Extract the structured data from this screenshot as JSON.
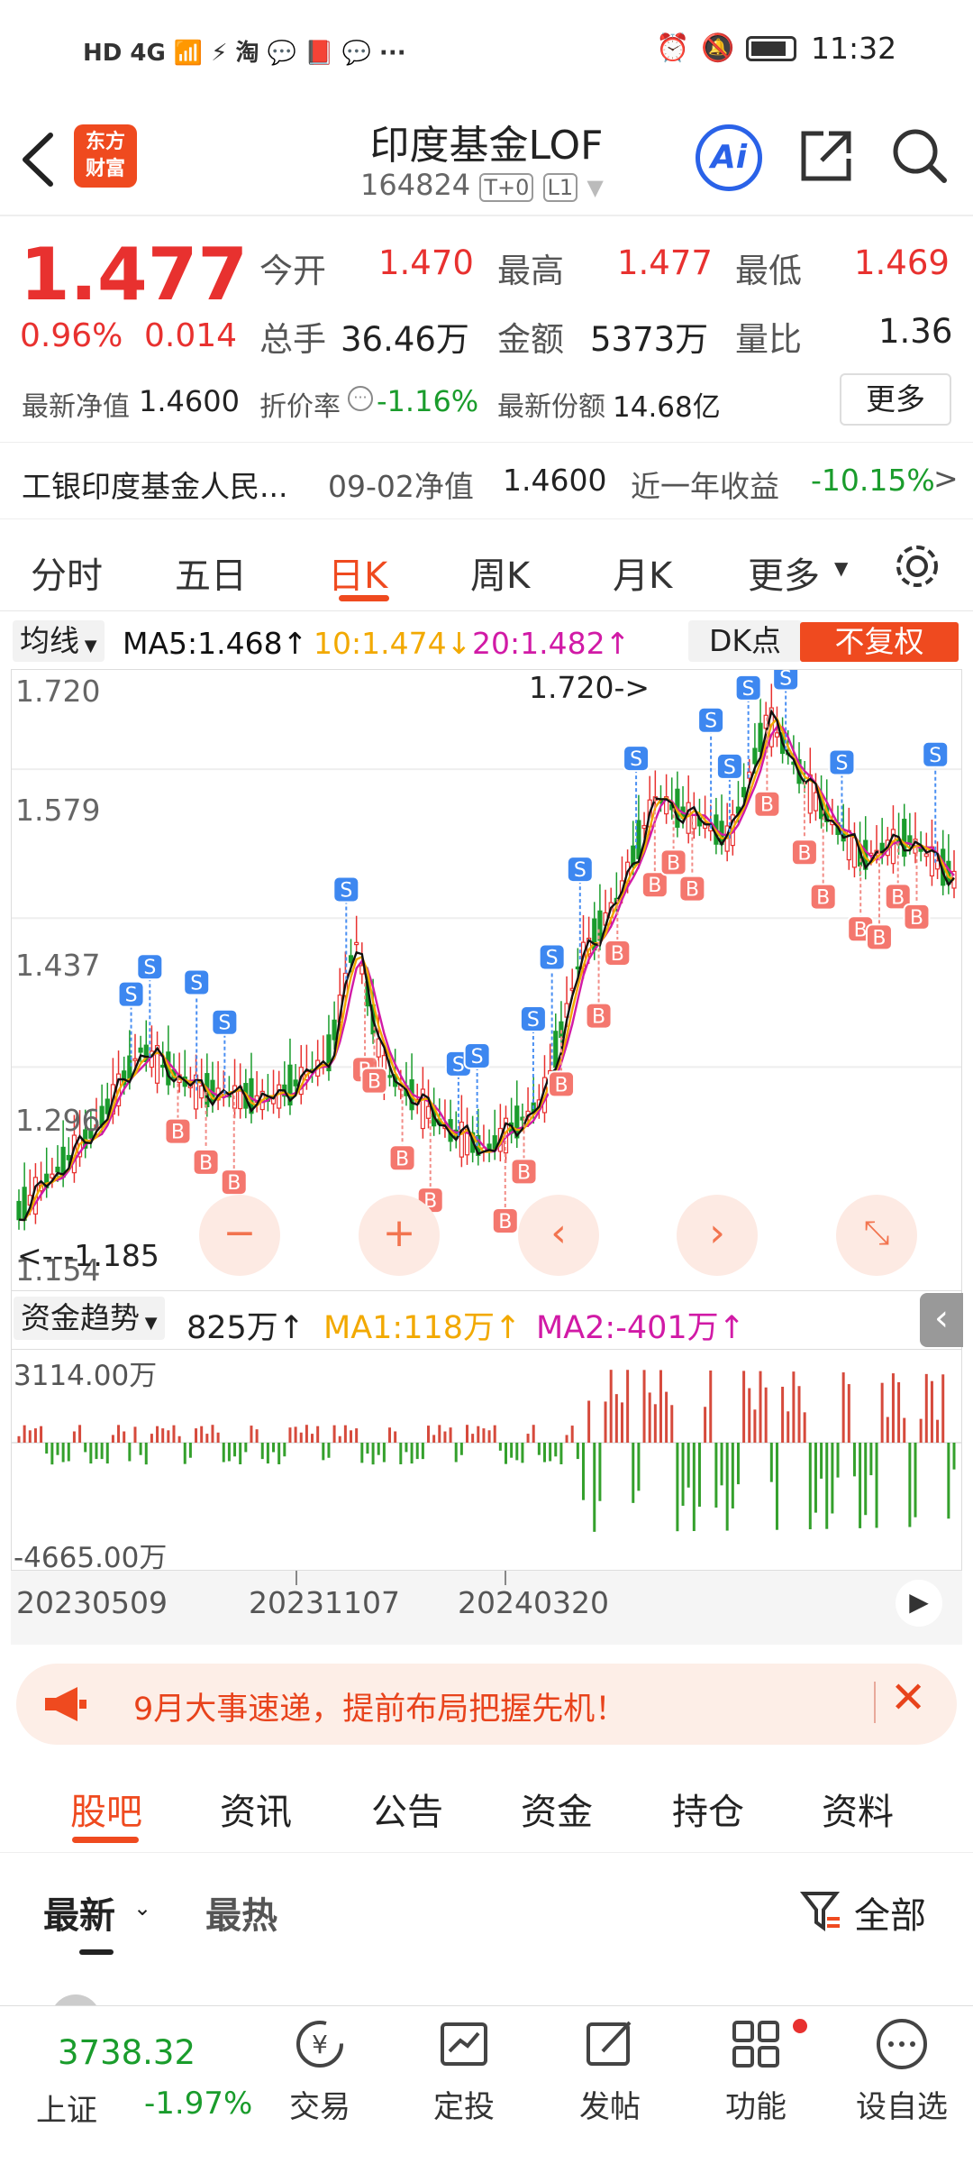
{
  "statusbar": {
    "left_icons": "HD 4G 📶 ⚡ 淘 💬 📕 💬 ···",
    "time": "11:32"
  },
  "header": {
    "logo_line1": "东方",
    "logo_line2": "财富",
    "title": "印度基金LOF",
    "code": "164824",
    "badge1": "T+0",
    "badge2": "L1",
    "ai_label": "Ai"
  },
  "quote": {
    "price": "1.477",
    "pct": "0.96%",
    "change": "0.014",
    "open_label": "今开",
    "open": "1.470",
    "high_label": "最高",
    "high": "1.477",
    "low_label": "最低",
    "low": "1.469",
    "vol_label": "总手",
    "vol": "36.46万",
    "amount_label": "金额",
    "amount": "5373万",
    "ratio_label": "量比",
    "ratio": "1.36",
    "nav_label": "最新净值",
    "nav": "1.4600",
    "discount_label": "折价率",
    "discount": "-1.16%",
    "shares_label": "最新份额",
    "shares": "14.68亿",
    "more_btn": "更多"
  },
  "fund": {
    "name": "工银印度基金人民...",
    "nav_date": "09-02净值",
    "nav_value": "1.4600",
    "year_label": "近一年收益",
    "year_value": "-10.15%",
    "arrow": ">"
  },
  "tabs": [
    "分时",
    "五日",
    "日K",
    "周K",
    "月K",
    "更多"
  ],
  "active_tab": "日K",
  "ma": {
    "selector": "均线",
    "ma5": "MA5:1.468↑",
    "ma10": "10:1.474↓",
    "ma20": "20:1.482↑",
    "dk": "DK点",
    "adjust": "不复权"
  },
  "chart_data": {
    "type": "candlestick",
    "y_ticks": [
      "1.720",
      "1.579",
      "1.437",
      "1.296",
      "1.154"
    ],
    "high_mark": "1.720->",
    "low_mark": "<---1.185",
    "ylim": [
      1.154,
      1.72
    ],
    "x_labels": [
      "20230509",
      "20231107",
      "20240320"
    ]
  },
  "fundflow": {
    "selector": "资金趋势",
    "value": "825万↑",
    "ma1": "MA1:118万↑",
    "ma2": "MA2:-401万↑",
    "top": "3114.00万",
    "bottom": "-4665.00万"
  },
  "banner": {
    "text": "9月大事速递，提前布局把握先机！"
  },
  "bottom_tabs": [
    "股吧",
    "资讯",
    "公告",
    "资金",
    "持仓",
    "资料"
  ],
  "sub_tabs": {
    "latest": "最新",
    "hot": "最热",
    "filter": "全部"
  },
  "index": {
    "value": "3738.32",
    "name": "上证",
    "pct": "-1.97%"
  },
  "nav": [
    {
      "label": "交易",
      "icon": "trade-icon"
    },
    {
      "label": "定投",
      "icon": "invest-icon"
    },
    {
      "label": "发帖",
      "icon": "post-icon"
    },
    {
      "label": "功能",
      "icon": "apps-icon"
    },
    {
      "label": "设自选",
      "icon": "more-icon"
    }
  ],
  "colors": {
    "up": "#e8312f",
    "down": "#1a9c2c",
    "accent": "#f2541b",
    "ma5": "#111111",
    "ma10": "#f2a900",
    "ma20": "#d11aa6"
  }
}
